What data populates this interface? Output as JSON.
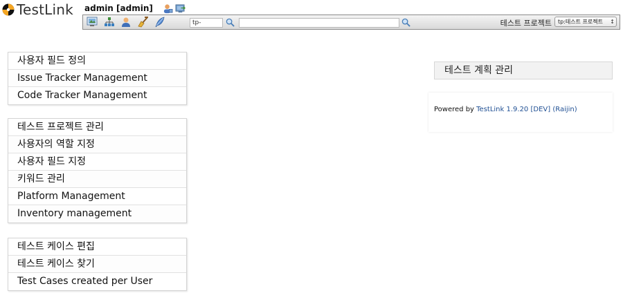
{
  "header": {
    "logo_text": "TestLink",
    "user": "admin [admin]"
  },
  "toolbar": {
    "icons": [
      "desktop-icon",
      "sitemap-icon",
      "user-icon",
      "broom-icon",
      "feather-icon"
    ],
    "testcase_search_value": "tp-",
    "global_search_value": "",
    "project_label": "테스트 프로젝트",
    "project_selected": "tp:테스트 프로젝트"
  },
  "menu_groups": [
    {
      "items": [
        "사용자 필드 정의",
        "Issue Tracker Management",
        "Code Tracker Management"
      ]
    },
    {
      "items": [
        "테스트 프로젝트 관리",
        "사용자의 역할 지정",
        "사용자 필드 지정",
        "키워드 관리",
        "Platform Management",
        "Inventory management"
      ]
    },
    {
      "items": [
        "테스트 케이스 편집",
        "테스트 케이스 찾기",
        "Test Cases created per User"
      ]
    }
  ],
  "right": {
    "plan_title": "테스트 계획 관리",
    "powered_prefix": "Powered by ",
    "powered_link": "TestLink 1.9.20 [DEV] (Raijin)"
  },
  "colors": {
    "link": "#1f4f93",
    "logo_orange": "#f5a623"
  }
}
